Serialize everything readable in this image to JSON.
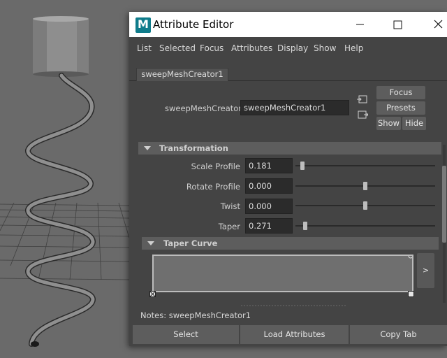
{
  "window": {
    "title": "Attribute Editor",
    "logo_letter": "M"
  },
  "menu": [
    "List",
    "Selected",
    "Focus",
    "Attributes",
    "Display",
    "Show",
    "Help"
  ],
  "node_tab": "sweepMeshCreator1",
  "node": {
    "label": "sweepMeshCreator:",
    "value": "sweepMeshCreator1"
  },
  "buttons": {
    "focus": "Focus",
    "presets": "Presets",
    "show": "Show",
    "hide": "Hide"
  },
  "transformation": {
    "header": "Transformation",
    "attributes": [
      {
        "label": "Scale Profile",
        "value": "0.181",
        "slider_fraction": 0.05
      },
      {
        "label": "Rotate Profile",
        "value": "0.000",
        "slider_fraction": 0.5
      },
      {
        "label": "Twist",
        "value": "0.000",
        "slider_fraction": 0.5
      },
      {
        "label": "Taper",
        "value": "0.271",
        "slider_fraction": 0.07
      }
    ]
  },
  "taper_curve": {
    "header": "Taper Curve",
    "expand_glyph": ">"
  },
  "notes": "Notes:  sweepMeshCreator1",
  "bottom_buttons": [
    "Select",
    "Load Attributes",
    "Copy Tab"
  ],
  "colors": {
    "accent_logo": "#0f7c8b",
    "viewport_bg": "#6a6a6a",
    "panel_bg": "#444444"
  }
}
